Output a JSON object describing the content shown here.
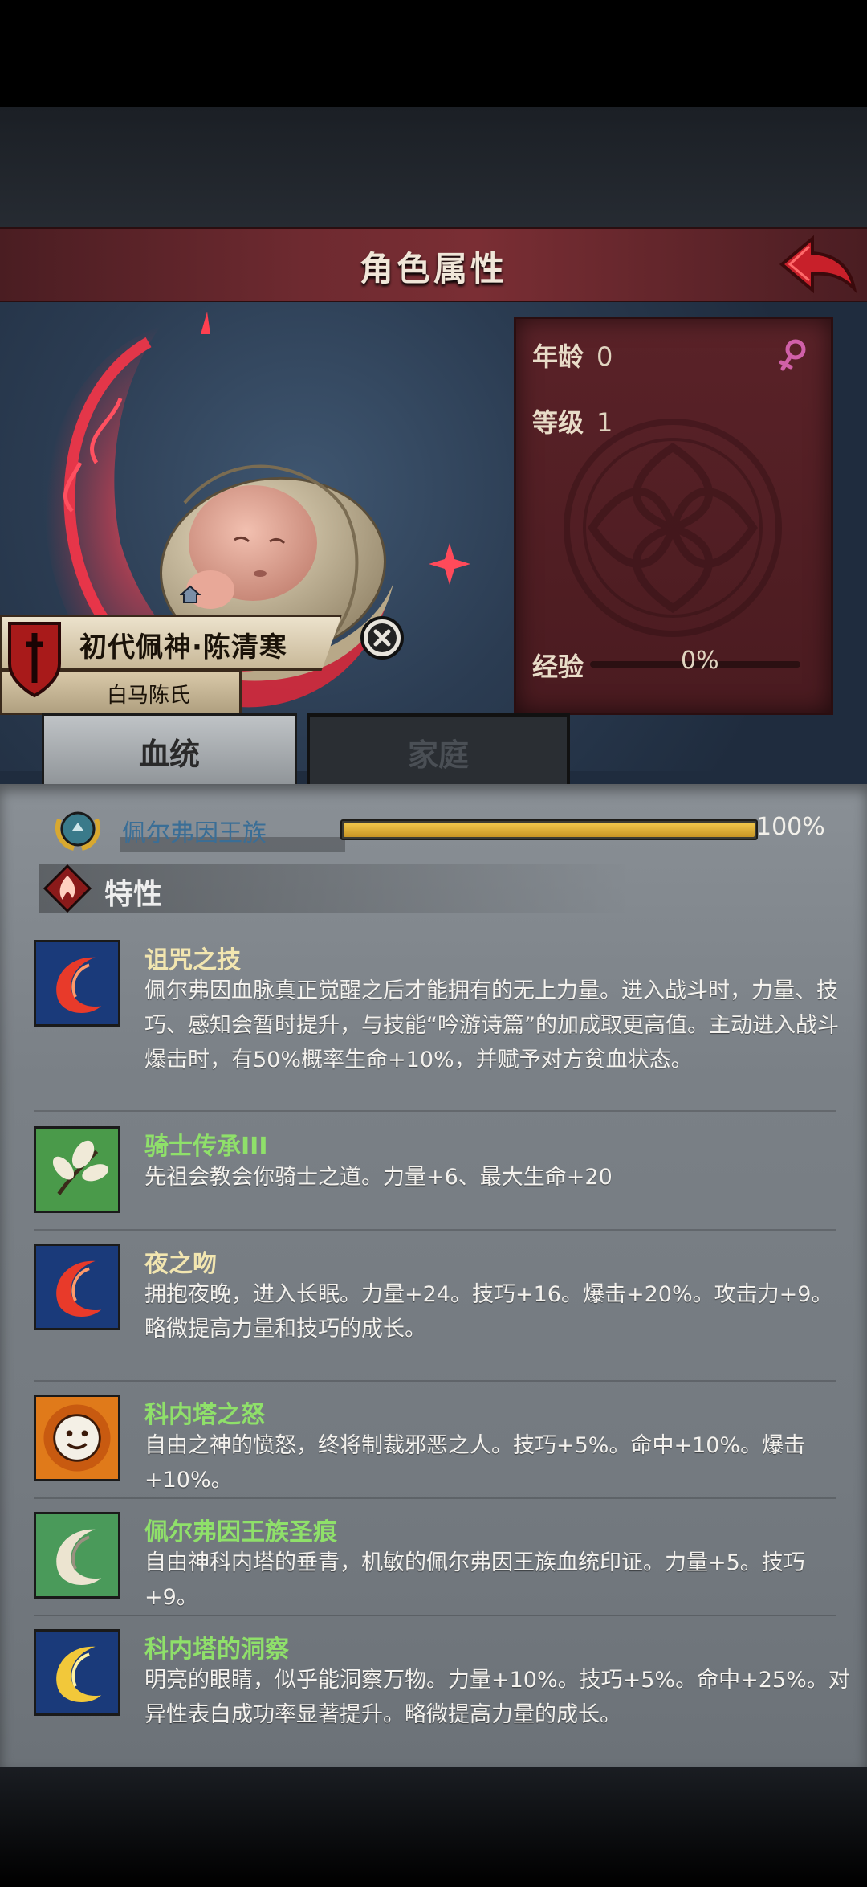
{
  "header": {
    "title": "角色属性"
  },
  "stats": {
    "age_label": "年龄",
    "age_value": "0",
    "level_label": "等级",
    "level_value": "1",
    "exp_label": "经验",
    "exp_value": "0%",
    "exp_fraction": 0
  },
  "character": {
    "name": "初代佩神·陈清寒",
    "house": "白马陈氏"
  },
  "tabs": [
    {
      "label": "血统"
    },
    {
      "label": "家庭"
    }
  ],
  "lineage": {
    "name": "佩尔弗因王族",
    "percent": "100%",
    "fraction": 1.0
  },
  "traits": {
    "title": "特性",
    "items": [
      {
        "name": "诅咒之技",
        "color": "#f2e6b0",
        "icon": "red-flame-crescent-icon",
        "desc": "佩尔弗因血脉真正觉醒之后才能拥有的无上力量。进入战斗时，力量、技巧、感知会暂时提升，与技能“吟游诗篇”的加成取更高值。主动进入战斗爆击时，有50%概率生命+10%，并赋予对方贫血状态。"
      },
      {
        "name": "骑士传承III",
        "color": "#8fe06a",
        "icon": "leaf-branch-icon",
        "desc": "先祖会教会你骑士之道。力量+6、最大生命+20"
      },
      {
        "name": "夜之吻",
        "color": "#f2e6b0",
        "icon": "red-flame-crescent-icon",
        "desc": "拥抱夜晚，进入长眠。力量+24。技巧+16。爆击+20%。攻击力+9。略微提高力量和技巧的成长。"
      },
      {
        "name": "科内塔之怒",
        "color": "#8fe06a",
        "icon": "angry-sun-face-icon",
        "desc": "自由之神的愤怒，终将制裁邪恶之人。技巧+5%。命中+10%。爆击+10%。"
      },
      {
        "name": "佩尔弗因王族圣痕",
        "color": "#8fe06a",
        "icon": "white-crescent-icon",
        "desc": "自由神科内塔的垂青，机敏的佩尔弗因王族血统印证。力量+5。技巧+9。"
      },
      {
        "name": "科内塔的洞察",
        "color": "#8fe06a",
        "icon": "yellow-crescent-icon",
        "desc": "明亮的眼睛，似乎能洞察万物。力量+10%。技巧+5%。命中+25%。对异性表白成功率显著提升。略微提高力量的成长。"
      }
    ]
  }
}
